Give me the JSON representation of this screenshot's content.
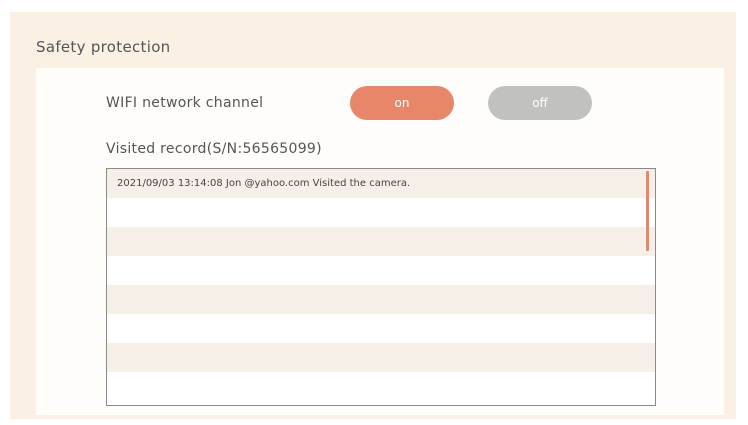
{
  "section": {
    "title": "Safety protection"
  },
  "wifi": {
    "label": "WIFI network channel",
    "on_label": "on",
    "off_label": "off"
  },
  "visited": {
    "label": "Visited record(S/N:56565099)",
    "records": [
      "2021/09/03  13:14:08  Jon @yahoo.com Visited the camera.",
      "",
      "",
      "",
      "",
      "",
      "",
      ""
    ]
  },
  "colors": {
    "accent": "#e8866a",
    "off_button": "#c1c1bf",
    "outer_background": "#faf0e4",
    "row_stripe": "#f5efe7"
  }
}
